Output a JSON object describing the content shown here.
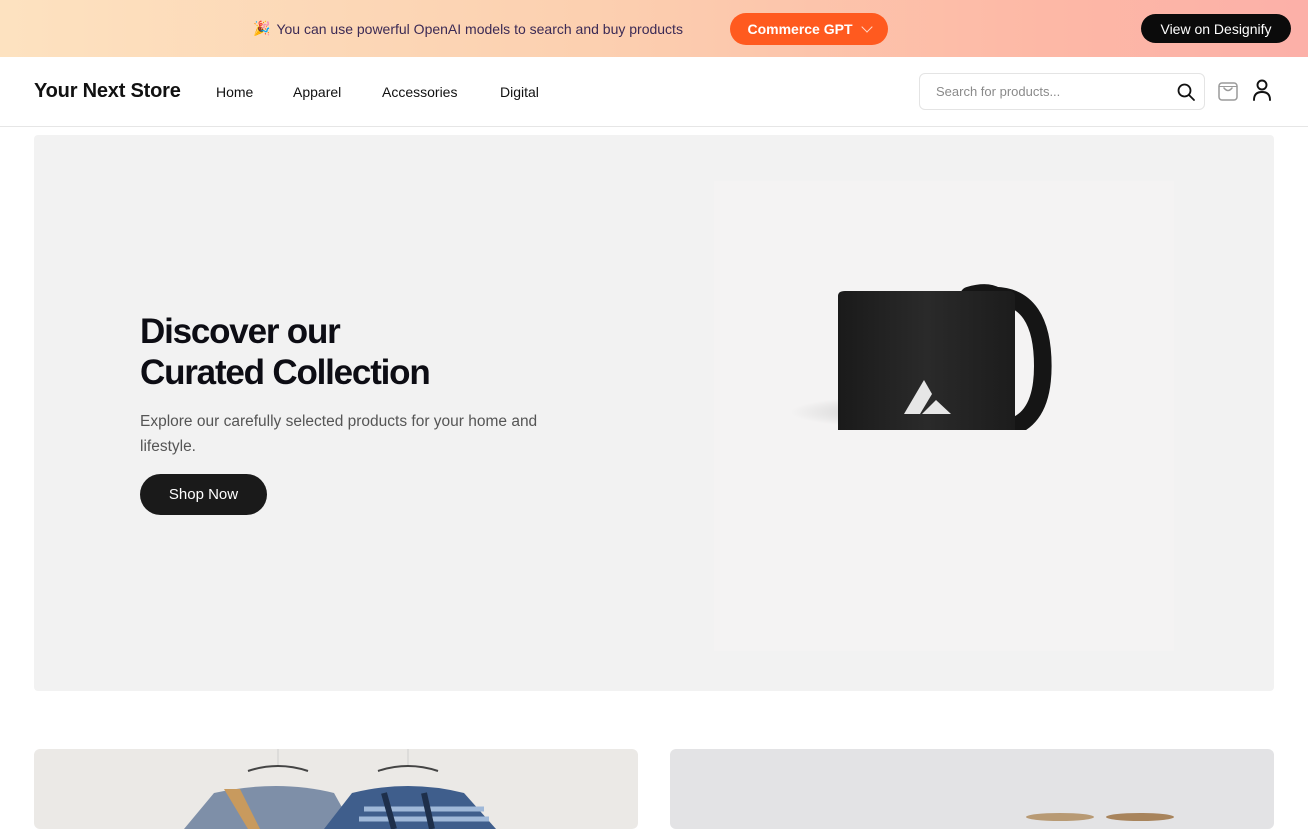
{
  "banner": {
    "message": "You can use powerful OpenAI models to search and buy products",
    "gpt_button": "Commerce GPT",
    "designify_button": "View on Designify",
    "party_icon": "party-popper-icon"
  },
  "header": {
    "logo": "Your Next Store",
    "nav": [
      "Home",
      "Apparel",
      "Accessories",
      "Digital"
    ],
    "search_placeholder": "Search for products...",
    "icons": [
      "search-icon",
      "cart-icon",
      "user-icon"
    ]
  },
  "hero": {
    "title_line1": "Discover our",
    "title_line2": "Curated Collection",
    "description": "Explore our carefully selected products for your home and lifestyle.",
    "cta": "Shop Now"
  },
  "colors": {
    "accent": "#ff5a1f",
    "dark": "#0b0b0b",
    "hero_bg": "#f2f2f2"
  }
}
